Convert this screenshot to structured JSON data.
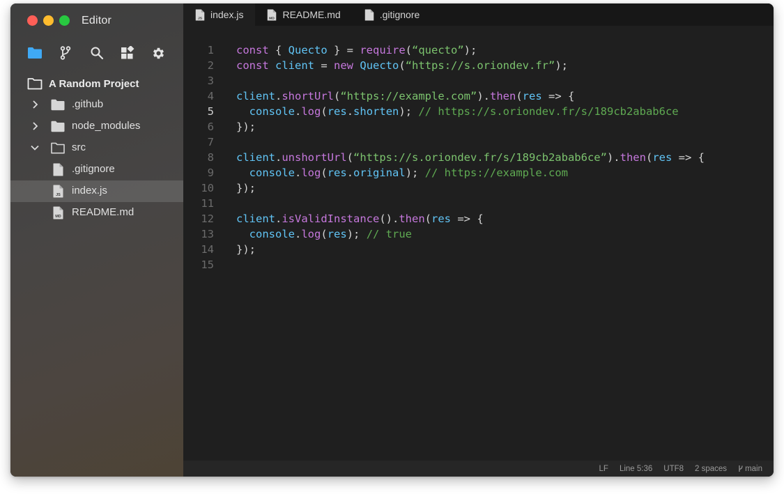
{
  "window": {
    "title": "Editor",
    "traffic_lights": {
      "close": "#ff5f57",
      "minimize": "#febc2e",
      "maximize": "#28c840"
    }
  },
  "sidebar": {
    "toolbar": [
      {
        "name": "folder-icon",
        "active": true,
        "color": "#3fa9f5"
      },
      {
        "name": "git-branch-icon",
        "active": false
      },
      {
        "name": "search-icon",
        "active": false
      },
      {
        "name": "extensions-icon",
        "active": false
      },
      {
        "name": "gear-icon",
        "active": false
      }
    ],
    "project_label": "A Random Project",
    "tree": [
      {
        "label": ".github",
        "type": "folder",
        "expanded": false
      },
      {
        "label": "node_modules",
        "type": "folder",
        "expanded": false
      },
      {
        "label": "src",
        "type": "folder",
        "expanded": true
      },
      {
        "label": ".gitignore",
        "type": "file",
        "badge": ""
      },
      {
        "label": "index.js",
        "type": "file",
        "badge": "JS",
        "selected": true
      },
      {
        "label": "README.md",
        "type": "file",
        "badge": "MD"
      }
    ]
  },
  "tabs": [
    {
      "label": "index.js",
      "badge": "JS",
      "active": true
    },
    {
      "label": "README.md",
      "badge": "MD",
      "active": false
    },
    {
      "label": ".gitignore",
      "badge": "",
      "active": false
    }
  ],
  "editor": {
    "current_line": 5,
    "lines": [
      {
        "num": "1",
        "tokens": [
          [
            "kw",
            "const"
          ],
          [
            "pl",
            " { "
          ],
          [
            "var",
            "Quecto"
          ],
          [
            "pl",
            " } = "
          ],
          [
            "fn",
            "require"
          ],
          [
            "pl",
            "("
          ],
          [
            "str",
            "“quecto”"
          ],
          [
            "pl",
            ");"
          ]
        ]
      },
      {
        "num": "2",
        "tokens": [
          [
            "kw",
            "const"
          ],
          [
            "pl",
            " "
          ],
          [
            "var",
            "client"
          ],
          [
            "pl",
            " = "
          ],
          [
            "kw",
            "new"
          ],
          [
            "pl",
            " "
          ],
          [
            "var",
            "Quecto"
          ],
          [
            "pl",
            "("
          ],
          [
            "str",
            "“https://s.oriondev.fr”"
          ],
          [
            "pl",
            ");"
          ]
        ]
      },
      {
        "num": "3",
        "tokens": []
      },
      {
        "num": "4",
        "tokens": [
          [
            "var",
            "client"
          ],
          [
            "pl",
            "."
          ],
          [
            "fn",
            "shortUrl"
          ],
          [
            "pl",
            "("
          ],
          [
            "str",
            "“https://example.com”"
          ],
          [
            "pl",
            ")."
          ],
          [
            "fn",
            "then"
          ],
          [
            "pl",
            "("
          ],
          [
            "var",
            "res"
          ],
          [
            "pl",
            " => {"
          ]
        ]
      },
      {
        "num": "5",
        "tokens": [
          [
            "pl",
            "  "
          ],
          [
            "var",
            "console"
          ],
          [
            "pl",
            "."
          ],
          [
            "fn",
            "log"
          ],
          [
            "pl",
            "("
          ],
          [
            "var",
            "res"
          ],
          [
            "pl",
            "."
          ],
          [
            "var",
            "shorten"
          ],
          [
            "pl",
            "); "
          ],
          [
            "cm",
            "// https://s.oriondev.fr/s/189cb2abab6ce"
          ]
        ]
      },
      {
        "num": "6",
        "tokens": [
          [
            "pl",
            "});"
          ]
        ]
      },
      {
        "num": "7",
        "tokens": []
      },
      {
        "num": "8",
        "tokens": [
          [
            "var",
            "client"
          ],
          [
            "pl",
            "."
          ],
          [
            "fn",
            "unshortUrl"
          ],
          [
            "pl",
            "("
          ],
          [
            "str",
            "“https://s.oriondev.fr/s/189cb2abab6ce”"
          ],
          [
            "pl",
            ")."
          ],
          [
            "fn",
            "then"
          ],
          [
            "pl",
            "("
          ],
          [
            "var",
            "res"
          ],
          [
            "pl",
            " => {"
          ]
        ]
      },
      {
        "num": "9",
        "tokens": [
          [
            "pl",
            "  "
          ],
          [
            "var",
            "console"
          ],
          [
            "pl",
            "."
          ],
          [
            "fn",
            "log"
          ],
          [
            "pl",
            "("
          ],
          [
            "var",
            "res"
          ],
          [
            "pl",
            "."
          ],
          [
            "var",
            "original"
          ],
          [
            "pl",
            "); "
          ],
          [
            "cm",
            "// https://example.com"
          ]
        ]
      },
      {
        "num": "10",
        "tokens": [
          [
            "pl",
            "});"
          ]
        ]
      },
      {
        "num": "11",
        "tokens": []
      },
      {
        "num": "12",
        "tokens": [
          [
            "var",
            "client"
          ],
          [
            "pl",
            "."
          ],
          [
            "fn",
            "isValidInstance"
          ],
          [
            "pl",
            "()."
          ],
          [
            "fn",
            "then"
          ],
          [
            "pl",
            "("
          ],
          [
            "var",
            "res"
          ],
          [
            "pl",
            " => {"
          ]
        ]
      },
      {
        "num": "13",
        "tokens": [
          [
            "pl",
            "  "
          ],
          [
            "var",
            "console"
          ],
          [
            "pl",
            "."
          ],
          [
            "fn",
            "log"
          ],
          [
            "pl",
            "("
          ],
          [
            "var",
            "res"
          ],
          [
            "pl",
            "); "
          ],
          [
            "cm",
            "// true"
          ]
        ]
      },
      {
        "num": "14",
        "tokens": [
          [
            "pl",
            "});"
          ]
        ]
      },
      {
        "num": "15",
        "tokens": []
      }
    ]
  },
  "status": {
    "line_ending": "LF",
    "cursor": "Line 5:36",
    "encoding": "UTF8",
    "indent": "2 spaces",
    "branch": "main"
  }
}
